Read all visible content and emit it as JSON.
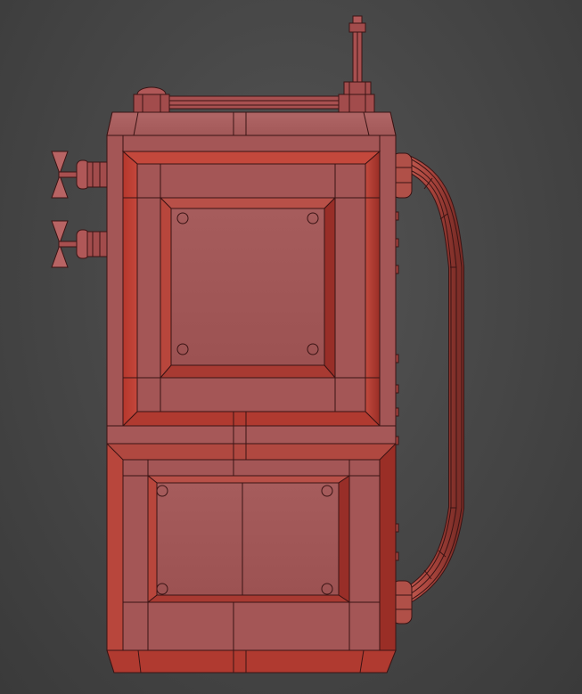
{
  "scene": {
    "subject": "radio-backpack-wireframe-model",
    "colors": {
      "background_center": "#555555",
      "background_edge": "#3a3a3a",
      "body_base": "#a85858",
      "body_light": "#b86868",
      "body_dark": "#8a3a3a",
      "bevel_red": "#c24a3e",
      "bevel_deep": "#9a2e26",
      "wire": "#3a1414"
    },
    "components": {
      "upper_panel_screws": 4,
      "lower_panel_screws": 4,
      "side_knobs": 2,
      "right_side_studs": 9
    }
  }
}
